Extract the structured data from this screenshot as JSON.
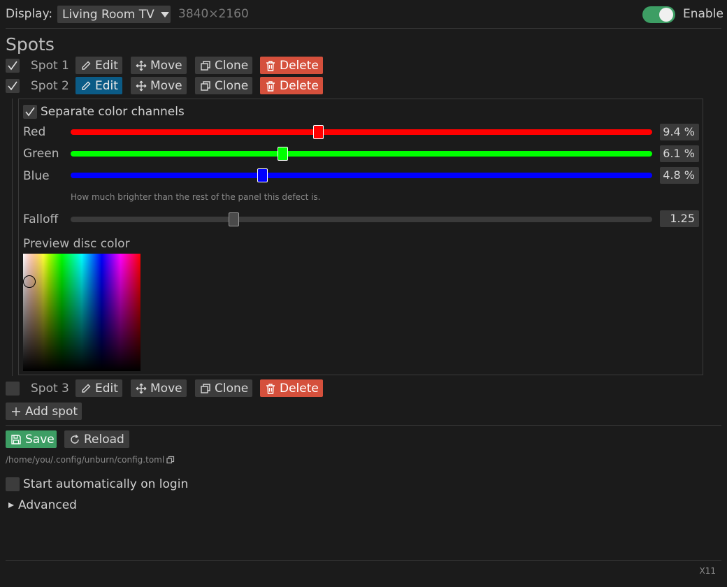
{
  "topbar": {
    "display_label": "Display:",
    "display_value": "Living Room TV",
    "resolution": "3840×2160",
    "enable_label": "Enable",
    "enabled": true
  },
  "spots": {
    "heading": "Spots",
    "items": [
      {
        "name": "Spot 1",
        "checked": true,
        "editing": false
      },
      {
        "name": "Spot 2",
        "checked": true,
        "editing": true
      },
      {
        "name": "Spot 3",
        "checked": false,
        "editing": false
      }
    ],
    "actions": {
      "edit": "Edit",
      "move": "Move",
      "clone": "Clone",
      "delete": "Delete"
    },
    "add_label": "Add spot"
  },
  "editor": {
    "separate_label": "Separate color channels",
    "separate_checked": true,
    "channels": [
      {
        "label": "Red",
        "value_text": "9.4 %",
        "fraction": 0.427,
        "color": "#ff0000"
      },
      {
        "label": "Green",
        "value_text": "6.1 %",
        "fraction": 0.365,
        "color": "#00ff00"
      },
      {
        "label": "Blue",
        "value_text": "4.8 %",
        "fraction": 0.33,
        "color": "#0000ff"
      }
    ],
    "hint": "How much brighter than the rest of the panel this defect is.",
    "falloff_label": "Falloff",
    "falloff_value": "1.25",
    "falloff_fraction": 0.28,
    "preview_label": "Preview disc color"
  },
  "footer": {
    "save_label": "Save",
    "reload_label": "Reload",
    "config_path": "/home/you/.config/unburn/config.toml",
    "autostart_label": "Start automatically on login",
    "advanced_label": "Advanced",
    "backend": "X11"
  },
  "icons": {
    "edit": "pencil-icon",
    "move": "move-arrows-icon",
    "clone": "clone-icon",
    "delete": "trash-icon",
    "add": "plus-icon",
    "save": "floppy-disk-icon",
    "reload": "reload-icon",
    "copy": "copy-icon",
    "dropdown": "caret-down-icon",
    "expand": "caret-right-icon",
    "check": "check-icon"
  }
}
